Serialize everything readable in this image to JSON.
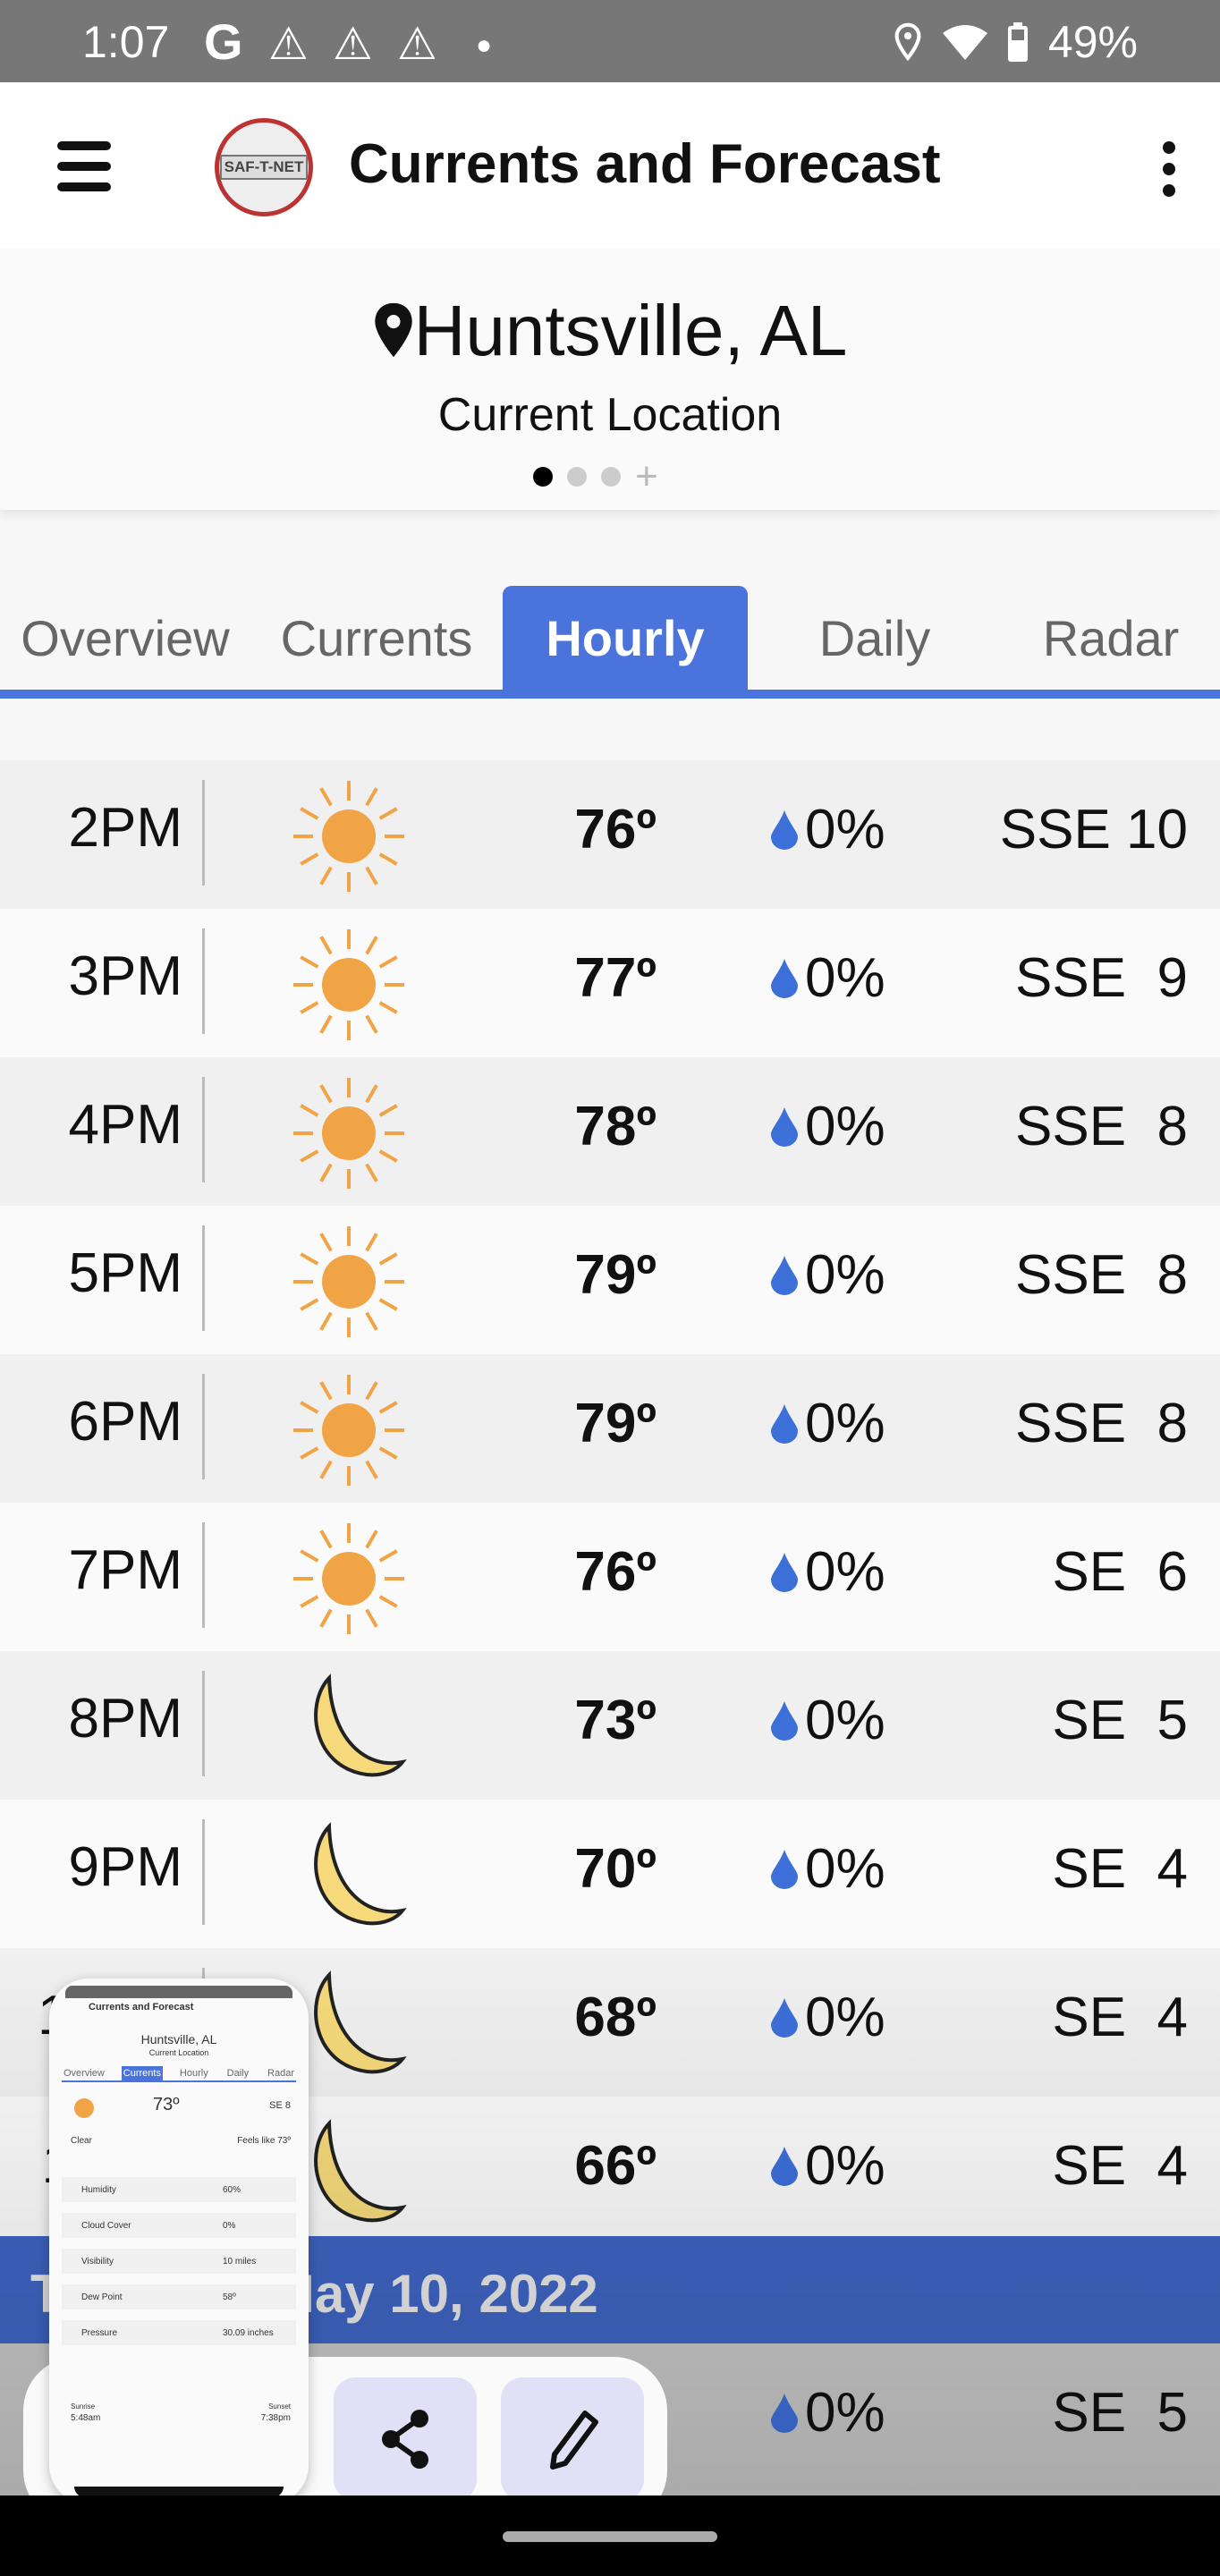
{
  "status_bar": {
    "time": "1:07",
    "google": "G",
    "battery": "49%",
    "icons": [
      "warning-icon",
      "warning-icon",
      "warning-icon",
      "dot-icon",
      "location-icon",
      "wifi-icon",
      "battery-icon"
    ]
  },
  "app_bar": {
    "title": "Currents and Forecast",
    "logo_text": "SAF-T-NET"
  },
  "location": {
    "city": "Huntsville, AL",
    "subtitle": "Current Location",
    "pages": 3,
    "active_page": 1
  },
  "tabs": [
    {
      "label": "Overview"
    },
    {
      "label": "Currents"
    },
    {
      "label": "Hourly",
      "active": true
    },
    {
      "label": "Daily"
    },
    {
      "label": "Radar"
    }
  ],
  "hourly": [
    {
      "time": "2PM",
      "icon": "sun",
      "temp": "76º",
      "precip": "0%",
      "wind": "SSE 10"
    },
    {
      "time": "3PM",
      "icon": "sun",
      "temp": "77º",
      "precip": "0%",
      "wind": "SSE  9"
    },
    {
      "time": "4PM",
      "icon": "sun",
      "temp": "78º",
      "precip": "0%",
      "wind": "SSE  8"
    },
    {
      "time": "5PM",
      "icon": "sun",
      "temp": "79º",
      "precip": "0%",
      "wind": "SSE  8"
    },
    {
      "time": "6PM",
      "icon": "sun",
      "temp": "79º",
      "precip": "0%",
      "wind": "SSE  8"
    },
    {
      "time": "7PM",
      "icon": "sun",
      "temp": "76º",
      "precip": "0%",
      "wind": "SE  6"
    },
    {
      "time": "8PM",
      "icon": "moon",
      "temp": "73º",
      "precip": "0%",
      "wind": "SE  5"
    },
    {
      "time": "9PM",
      "icon": "moon",
      "temp": "70º",
      "precip": "0%",
      "wind": "SE  4"
    },
    {
      "time": "10PM",
      "icon": "moon",
      "temp": "68º",
      "precip": "0%",
      "wind": "SE  4"
    },
    {
      "time": "11PM",
      "icon": "moon",
      "temp": "66º",
      "precip": "0%",
      "wind": "SE  4"
    }
  ],
  "date_band": "Tuesday, May 10, 2022",
  "next_row": {
    "precip": "0%",
    "wind": "SE  5"
  },
  "colors": {
    "accent": "#4a73dc",
    "date_band": "#3e64c2",
    "sun": "#f0a445",
    "moon": "#f5d97a",
    "drop": "#3d6fd9"
  },
  "screenshot_toolbar": {
    "buttons": [
      "share-icon",
      "edit-icon"
    ]
  },
  "thumbnail": {
    "title": "Currents and Forecast",
    "city": "Huntsville, AL",
    "subtitle": "Current Location",
    "tabs": [
      "Overview",
      "Currents",
      "Hourly",
      "Daily",
      "Radar"
    ],
    "temp": "73º",
    "wind": "SE 8",
    "condition": "Clear",
    "feels_like": "Feels like 73º",
    "details": [
      {
        "label": "Humidity",
        "value": "60%"
      },
      {
        "label": "Cloud Cover",
        "value": "0%"
      },
      {
        "label": "Visibility",
        "value": "10 miles"
      },
      {
        "label": "Dew Point",
        "value": "58º"
      },
      {
        "label": "Pressure",
        "value": "30.09 inches"
      }
    ],
    "sunrise_label": "Sunrise",
    "sunrise": "5:48am",
    "sunset_label": "Sunset",
    "sunset": "7:38pm"
  }
}
